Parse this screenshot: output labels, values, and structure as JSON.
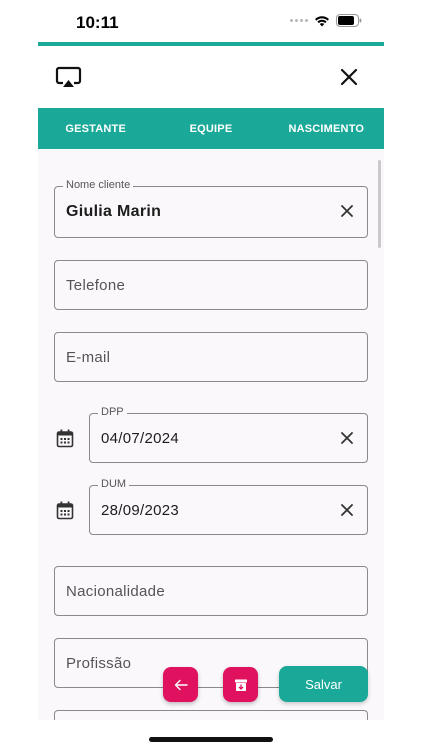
{
  "status_bar": {
    "time": "10:11"
  },
  "tabs": [
    {
      "label": "GESTANTE"
    },
    {
      "label": "EQUIPE"
    },
    {
      "label": "NASCIMENTO"
    }
  ],
  "form": {
    "nome_cliente": {
      "label": "Nome cliente",
      "value": "Giulia Marin"
    },
    "telefone": {
      "placeholder": "Telefone"
    },
    "email": {
      "placeholder": "E-mail"
    },
    "dpp": {
      "label": "DPP",
      "value": "04/07/2024"
    },
    "dum": {
      "label": "DUM",
      "value": "28/09/2023"
    },
    "nacionalidade": {
      "placeholder": "Nacionalidade"
    },
    "profissao": {
      "placeholder": "Profissão"
    }
  },
  "actions": {
    "save_label": "Salvar"
  },
  "colors": {
    "primary": "#1aa898",
    "accent": "#e0115f",
    "indicator": "#4a5aa8"
  },
  "icons": [
    "airplay-icon",
    "close-icon",
    "calendar-icon",
    "clear-icon",
    "arrow-left-icon",
    "archive-icon",
    "wifi-icon",
    "battery-icon"
  ]
}
